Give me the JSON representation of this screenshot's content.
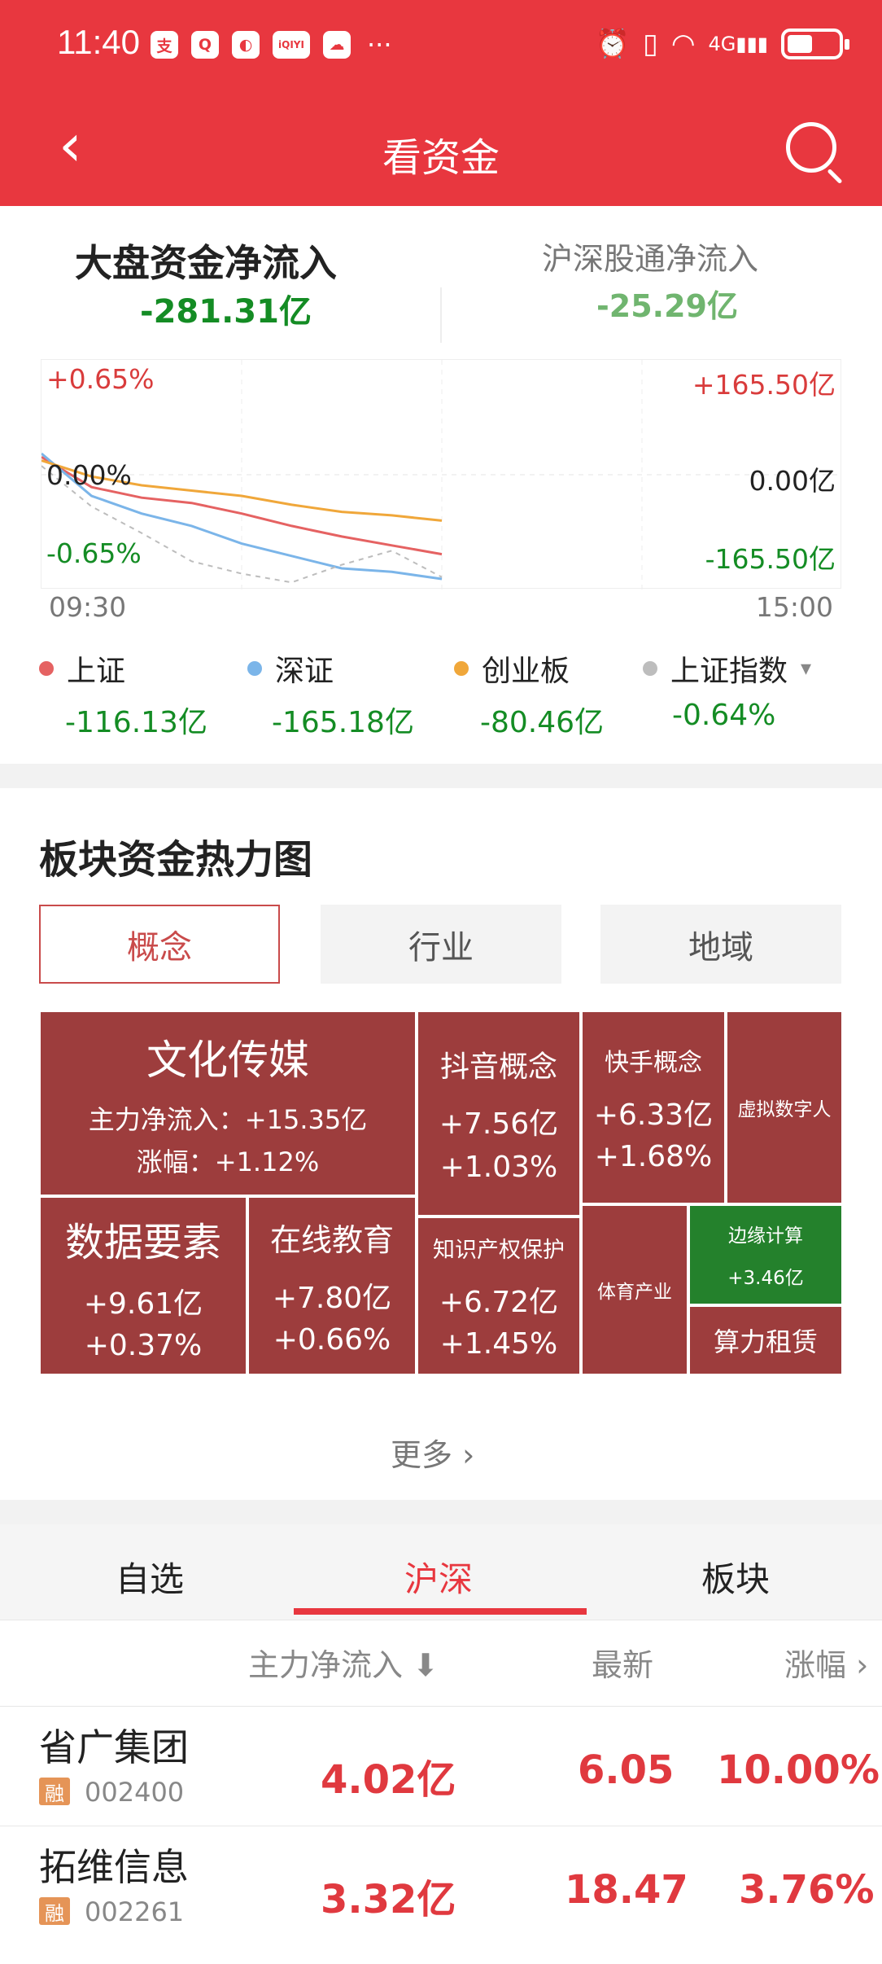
{
  "status": {
    "time": "11:40",
    "app_icons": [
      "支",
      "Q",
      "◐",
      "iQIYI",
      "☁"
    ],
    "dots": "···",
    "alarm": "⏰",
    "vibrate": "▯",
    "wifi": "◠",
    "signal": "4G▮▮▮"
  },
  "header": {
    "back_label": "‹",
    "title": "看资金"
  },
  "summary": {
    "left_title": "大盘资金净流入",
    "left_value": "-281.31亿",
    "right_title": "沪深股通净流入",
    "right_value": "-25.29亿"
  },
  "chart": {
    "y_left_top": "+0.65%",
    "y_left_mid": "0.00%",
    "y_left_bottom": "-0.65%",
    "y_right_top": "+165.50亿",
    "y_right_mid": "0.00亿",
    "y_right_bottom": "-165.50亿",
    "x_start": "09:30",
    "x_end": "15:00",
    "colors": {
      "shanghai": "#e56262",
      "shenzhen": "#7bb5e9",
      "chinext": "#f0a73a",
      "index": "#bdbdbd"
    }
  },
  "chart_data": {
    "type": "line",
    "x": [
      "09:30",
      "09:45",
      "10:00",
      "10:15",
      "10:30",
      "10:45",
      "11:00",
      "11:15",
      "11:30"
    ],
    "series": [
      {
        "name": "上证",
        "values": [
          0.1,
          -0.07,
          -0.13,
          -0.16,
          -0.22,
          -0.29,
          -0.35,
          -0.4,
          -0.45
        ]
      },
      {
        "name": "深证",
        "values": [
          0.12,
          -0.12,
          -0.22,
          -0.29,
          -0.39,
          -0.46,
          -0.53,
          -0.55,
          -0.59
        ]
      },
      {
        "name": "创业板",
        "values": [
          0.08,
          -0.01,
          -0.06,
          -0.09,
          -0.12,
          -0.17,
          -0.21,
          -0.23,
          -0.26
        ]
      },
      {
        "name": "上证指数",
        "values": [
          0.05,
          -0.18,
          -0.33,
          -0.49,
          -0.56,
          -0.61,
          -0.51,
          -0.43,
          -0.58
        ]
      }
    ],
    "ylim": [
      -0.65,
      0.65
    ]
  },
  "legend": [
    {
      "label": "上证",
      "value": "-116.13亿",
      "color": "#e56262"
    },
    {
      "label": "深证",
      "value": "-165.18亿",
      "color": "#7bb5e9"
    },
    {
      "label": "创业板",
      "value": "-80.46亿",
      "color": "#f0a73a"
    },
    {
      "label": "上证指数",
      "value": "-0.64%",
      "color": "#bdbdbd",
      "arrow": "▾"
    }
  ],
  "heatmap": {
    "title": "板块资金热力图",
    "tabs": [
      "概念",
      "行业",
      "地域"
    ],
    "tiles": [
      {
        "name": "文化传媒",
        "line1": "主力净流入：+15.35亿",
        "line2": "涨幅：+1.12%"
      },
      {
        "name": "抖音概念",
        "line1": "+7.56亿",
        "line2": "+1.03%"
      },
      {
        "name": "快手概念",
        "line1": "+6.33亿",
        "line2": "+1.68%"
      },
      {
        "name": "虚拟数字人"
      },
      {
        "name": "数据要素",
        "line1": "+9.61亿",
        "line2": "+0.37%"
      },
      {
        "name": "在线教育",
        "line1": "+7.80亿",
        "line2": "+0.66%"
      },
      {
        "name": "知识产权保护",
        "line1": "+6.72亿",
        "line2": "+1.45%"
      },
      {
        "name": "体育产业"
      },
      {
        "name": "边缘计算",
        "line1": "+3.46亿"
      },
      {
        "name": "算力租赁"
      }
    ],
    "more": "更多 ›"
  },
  "market_tabs": [
    "自选",
    "沪深",
    "板块"
  ],
  "table": {
    "headers": {
      "flow": "主力净流入 ⬇",
      "latest": "最新",
      "change": "涨幅 ›"
    },
    "rows": [
      {
        "name": "省广集团",
        "badge": "融",
        "code": "002400",
        "flow": "4.02亿",
        "latest": "6.05",
        "change": "10.00%"
      },
      {
        "name": "拓维信息",
        "badge": "融",
        "code": "002261",
        "flow": "3.32亿",
        "latest": "18.47",
        "change": "3.76%"
      }
    ]
  }
}
